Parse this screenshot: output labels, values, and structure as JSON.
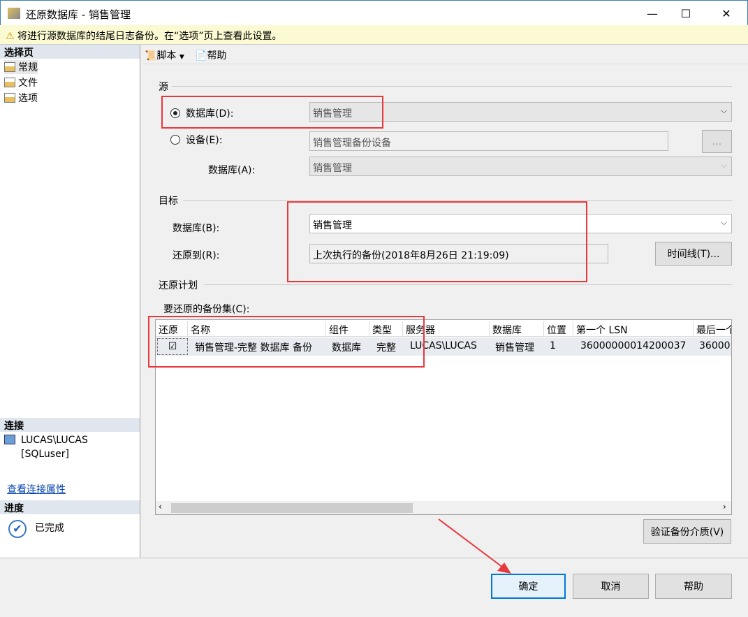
{
  "window": {
    "title": "还原数据库 - 销售管理",
    "minimize": "—",
    "maximize": "☐",
    "close": "✕"
  },
  "warning": "将进行源数据库的结尾日志备份。在“选项”页上查看此设置。",
  "sidebar": {
    "header": "选择页",
    "items": [
      {
        "label": "常规"
      },
      {
        "label": "文件"
      },
      {
        "label": "选项"
      }
    ],
    "connection_header": "连接",
    "server": "LUCAS\\LUCAS",
    "user": "[SQLuser]",
    "view_connection_link": "查看连接属性",
    "progress_header": "进度",
    "progress_status": "已完成"
  },
  "toolbar": {
    "script": "脚本",
    "help": "帮助"
  },
  "source": {
    "title": "源",
    "database_label": "数据库(D):",
    "database_value": "销售管理",
    "device_label": "设备(E):",
    "device_value": "销售管理备份设备",
    "browse": "...",
    "db_label": "数据库(A):",
    "db_value": "销售管理",
    "selected": "database"
  },
  "target": {
    "title": "目标",
    "database_label": "数据库(B):",
    "database_value": "销售管理",
    "restore_to_label": "还原到(R):",
    "restore_to_value": "上次执行的备份(2018年8月26日 21:19:09)",
    "timeline": "时间线(T)..."
  },
  "plan": {
    "title": "还原计划",
    "backupsets_label": "要还原的备份集(C):",
    "columns": [
      "还原",
      "名称",
      "组件",
      "类型",
      "服务器",
      "数据库",
      "位置",
      "第一个 LSN",
      "最后一个"
    ],
    "rows": [
      {
        "restore": true,
        "name": "销售管理-完整 数据库 备份",
        "component": "数据库",
        "type": "完整",
        "server": "LUCAS\\LUCAS",
        "database": "销售管理",
        "position": "1",
        "first_lsn": "36000000014200037",
        "last_lsn": "36000"
      }
    ],
    "verify": "验证备份介质(V)"
  },
  "buttons": {
    "ok": "确定",
    "cancel": "取消",
    "help": "帮助"
  }
}
